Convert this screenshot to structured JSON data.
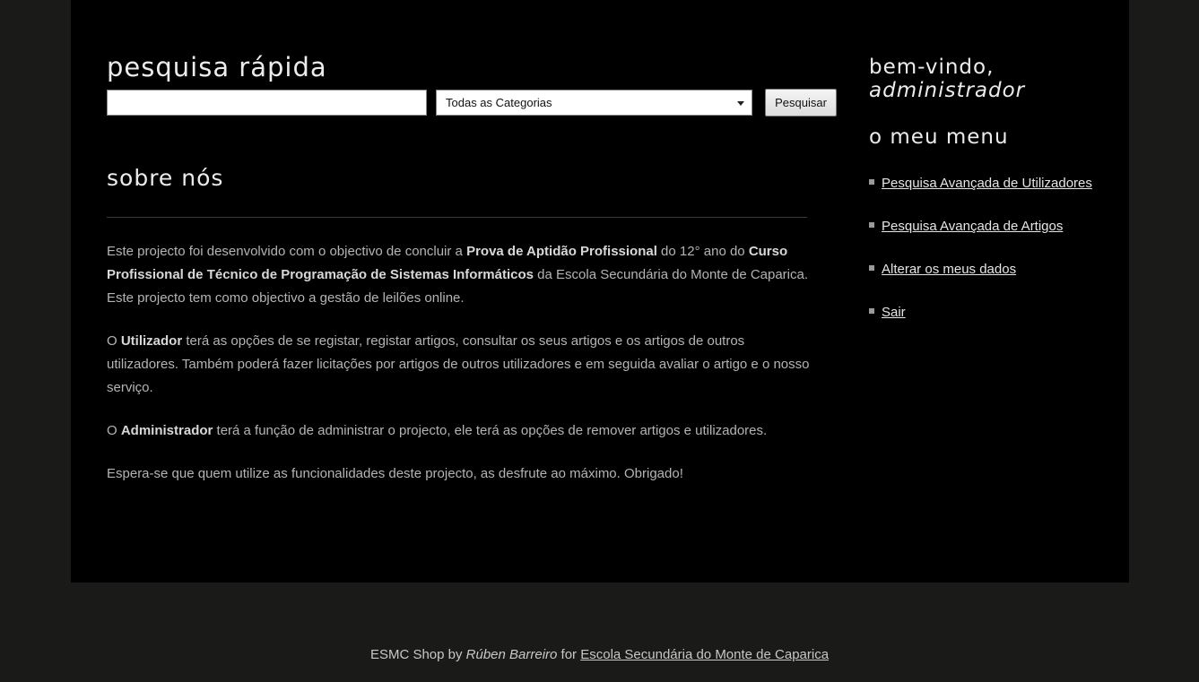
{
  "search": {
    "title": "pesquisa rápida",
    "input_value": "",
    "category_selected": "Todas as Categorias",
    "button_label": "Pesquisar"
  },
  "about": {
    "title": "sobre nós",
    "p1": {
      "t1": "Este projecto foi desenvolvido com o objectivo de concluir a ",
      "b1": "Prova de Aptidão Profissional",
      "t2": " do 12° ano do ",
      "b2": "Curso Profissional de Técnico de Programação de Sistemas Informáticos",
      "t3": " da Escola Secundária do Monte de Caparica. Este projecto tem como objectivo a gestão de leilões online."
    },
    "p2": {
      "t1": "O ",
      "b1": "Utilizador",
      "t2": " terá as opções de se registar, registar artigos, consultar os seus artigos e os artigos de outros utilizadores. Também poderá fazer licitações por artigos de outros utilizadores e em seguida avaliar o artigo e o nosso serviço."
    },
    "p3": {
      "t1": "O ",
      "b1": "Administrador",
      "t2": " terá a função de administrar o projecto, ele terá as opções de remover artigos e utilizadores."
    },
    "p4": "Espera-se que quem utilize as funcionalidades deste projecto, as desfrute ao máximo. Obrigado!"
  },
  "sidebar": {
    "welcome": "bem-vindo,",
    "username": "administrador",
    "menu_title": "o meu menu",
    "items": [
      {
        "label": "Pesquisa Avançada de Utilizadores"
      },
      {
        "label": "Pesquisa Avançada de Artigos"
      },
      {
        "label": "Alterar os meus dados"
      },
      {
        "label": "Sair"
      }
    ]
  },
  "footer": {
    "t1": "ESMC Shop by ",
    "author": "Rúben Barreiro",
    "t2": " for ",
    "link": "Escola Secundária do Monte de Caparica"
  }
}
